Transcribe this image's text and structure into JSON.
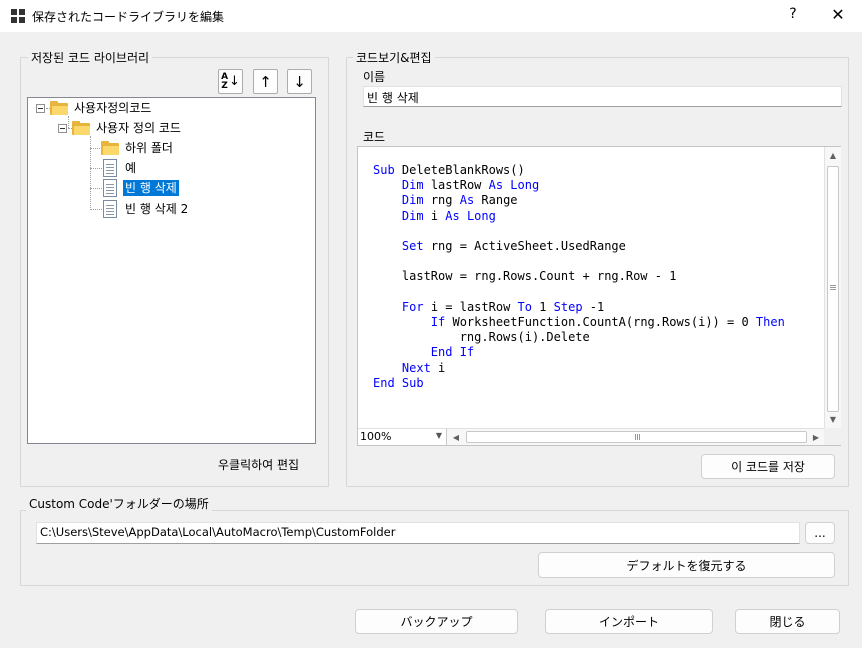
{
  "window": {
    "title": "保存されたコードライブラリを編集",
    "help_glyph": "?",
    "close_glyph": "✕"
  },
  "library_panel": {
    "legend": "저장된 코드 라이브러리",
    "toolbar": {
      "sort_glyph": "A↓Z",
      "move_up_glyph": "↑",
      "move_down_glyph": "↓"
    },
    "tree": [
      {
        "label": "사용자정의코드",
        "icon": "folder-icon"
      },
      {
        "label": "사용자 정의 코드",
        "icon": "folder-icon"
      },
      {
        "label": "하위 폴더",
        "icon": "folder-icon"
      },
      {
        "label": "예",
        "icon": "document-icon"
      },
      {
        "label": "빈 행 삭제",
        "icon": "document-icon",
        "selected": true
      },
      {
        "label": "빈 행 삭제 2",
        "icon": "document-icon"
      }
    ],
    "hint": "우클릭하여 편집"
  },
  "code_panel": {
    "legend": "코드보기&편집",
    "name_label": "이름",
    "name_value": "빈 행 삭제",
    "code_label": "코드",
    "code_lines": [
      [
        {
          "k": true,
          "t": "Sub"
        },
        {
          "t": " DeleteBlankRows()"
        }
      ],
      [
        {
          "t": "    "
        },
        {
          "k": true,
          "t": "Dim"
        },
        {
          "t": " lastRow "
        },
        {
          "k": true,
          "t": "As Long"
        }
      ],
      [
        {
          "t": "    "
        },
        {
          "k": true,
          "t": "Dim"
        },
        {
          "t": " rng "
        },
        {
          "k": true,
          "t": "As"
        },
        {
          "t": " Range"
        }
      ],
      [
        {
          "t": "    "
        },
        {
          "k": true,
          "t": "Dim"
        },
        {
          "t": " i "
        },
        {
          "k": true,
          "t": "As Long"
        }
      ],
      [
        {
          "t": ""
        }
      ],
      [
        {
          "t": "    "
        },
        {
          "k": true,
          "t": "Set"
        },
        {
          "t": " rng = ActiveSheet.UsedRange"
        }
      ],
      [
        {
          "t": ""
        }
      ],
      [
        {
          "t": "    lastRow = rng.Rows.Count + rng.Row - 1"
        }
      ],
      [
        {
          "t": ""
        }
      ],
      [
        {
          "t": "    "
        },
        {
          "k": true,
          "t": "For"
        },
        {
          "t": " i = lastRow "
        },
        {
          "k": true,
          "t": "To"
        },
        {
          "t": " 1 "
        },
        {
          "k": true,
          "t": "Step"
        },
        {
          "t": " -1"
        }
      ],
      [
        {
          "t": "        "
        },
        {
          "k": true,
          "t": "If"
        },
        {
          "t": " WorksheetFunction.CountA(rng.Rows(i)) = 0 "
        },
        {
          "k": true,
          "t": "Then"
        }
      ],
      [
        {
          "t": "            rng.Rows(i).Delete"
        }
      ],
      [
        {
          "t": "        "
        },
        {
          "k": true,
          "t": "End If"
        }
      ],
      [
        {
          "t": "    "
        },
        {
          "k": true,
          "t": "Next"
        },
        {
          "t": " i"
        }
      ],
      [
        {
          "k": true,
          "t": "End Sub"
        }
      ]
    ],
    "zoom": "100%",
    "save_button": "이 코드를 저장"
  },
  "folder_panel": {
    "legend": "Custom Code'フォルダーの場所",
    "path": "C:\\Users\\Steve\\AppData\\Local\\AutoMacro\\Temp\\CustomFolder",
    "browse_button": "...",
    "restore_button": "デフォルトを復元する"
  },
  "footer": {
    "backup_button": "バックアップ",
    "import_button": "インポート",
    "close_button": "閉じる"
  },
  "colors": {
    "keyword": "#0000ff",
    "selection": "#0078d7",
    "folder": "#fbd86b"
  }
}
